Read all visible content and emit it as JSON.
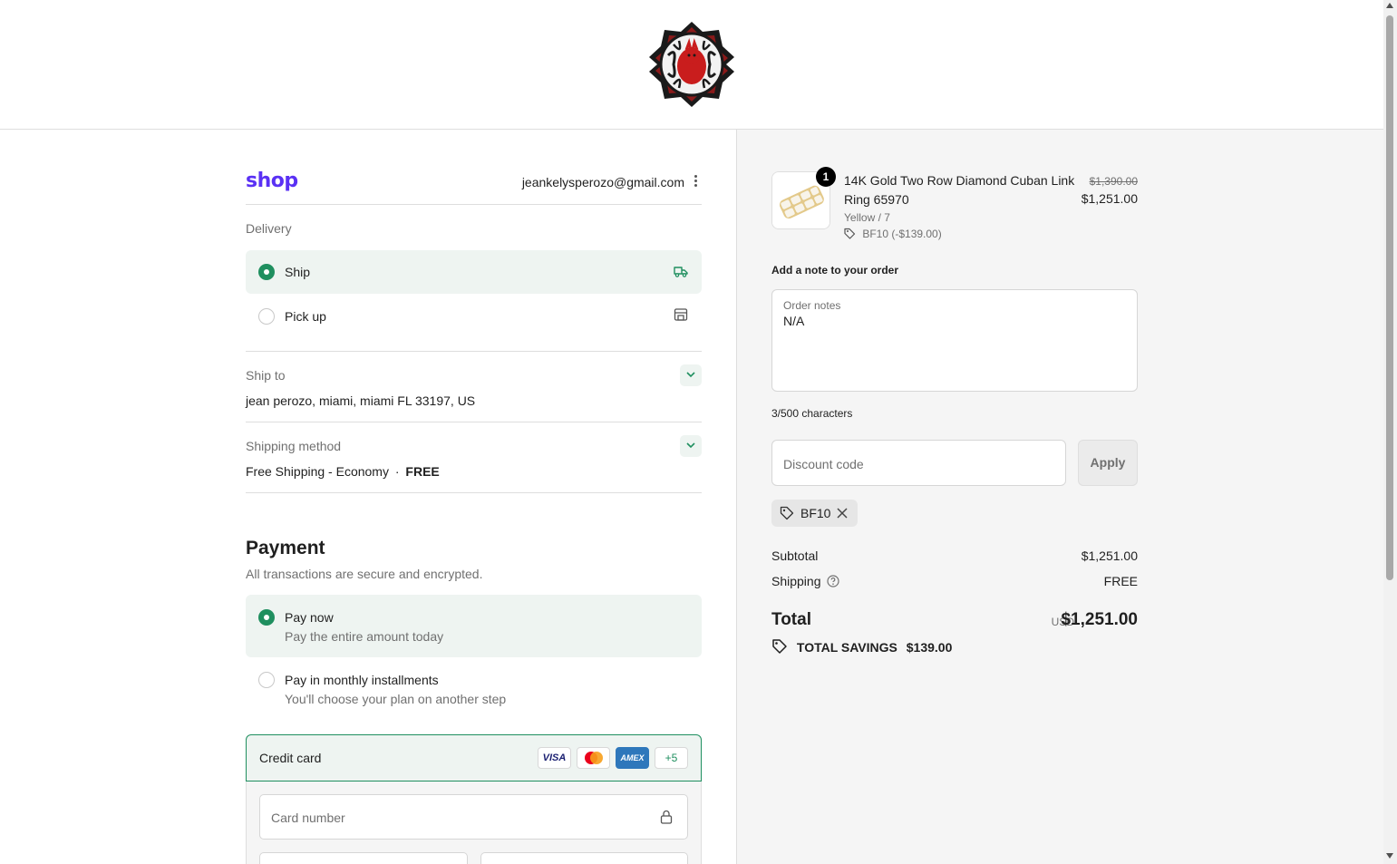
{
  "header": {
    "logo_icon": "brand-emblem-icon"
  },
  "account": {
    "shop_label": "shop",
    "email": "jeankelysperozo@gmail.com"
  },
  "delivery": {
    "title": "Delivery",
    "options": [
      {
        "label": "Ship",
        "selected": true,
        "icon": "truck-icon"
      },
      {
        "label": "Pick up",
        "selected": false,
        "icon": "store-icon"
      }
    ]
  },
  "ship_to": {
    "title": "Ship to",
    "value": "jean perozo, miami, miami FL 33197, US"
  },
  "shipping_method": {
    "title": "Shipping method",
    "value": "Free Shipping - Economy",
    "separator": "·",
    "price": "FREE"
  },
  "payment": {
    "title": "Payment",
    "subtitle": "All transactions are secure and encrypted.",
    "options": [
      {
        "label": "Pay now",
        "sub": "Pay the entire amount today",
        "selected": true
      },
      {
        "label": "Pay in monthly installments",
        "sub": "You'll choose your plan on another step",
        "selected": false
      }
    ],
    "credit_card": {
      "label": "Credit card",
      "brands": [
        "VISA",
        "mastercard",
        "AMEX",
        "+5"
      ],
      "card_number_placeholder": "Card number"
    }
  },
  "order": {
    "item": {
      "quantity": "1",
      "name": "14K Gold Two Row Diamond Cuban Link Ring 65970",
      "variant": "Yellow / 7",
      "discount": "BF10 (-$139.00)",
      "original_price": "$1,390.00",
      "price": "$1,251.00"
    },
    "note_title": "Add a note to your order",
    "notes_label": "Order notes",
    "notes_value": "N/A",
    "char_count": "3/500 characters",
    "discount_placeholder": "Discount code",
    "apply_label": "Apply",
    "applied_code": "BF10",
    "subtotal_label": "Subtotal",
    "subtotal": "$1,251.00",
    "shipping_label": "Shipping",
    "shipping": "FREE",
    "total_label": "Total",
    "currency": "USD",
    "total": "$1,251.00",
    "savings_label": "TOTAL SAVINGS",
    "savings": "$139.00"
  },
  "colors": {
    "accent": "#1f8f5f",
    "shop_brand": "#5a31f4",
    "selected_bg": "#eef4f1",
    "summary_bg": "#f5f5f5"
  }
}
